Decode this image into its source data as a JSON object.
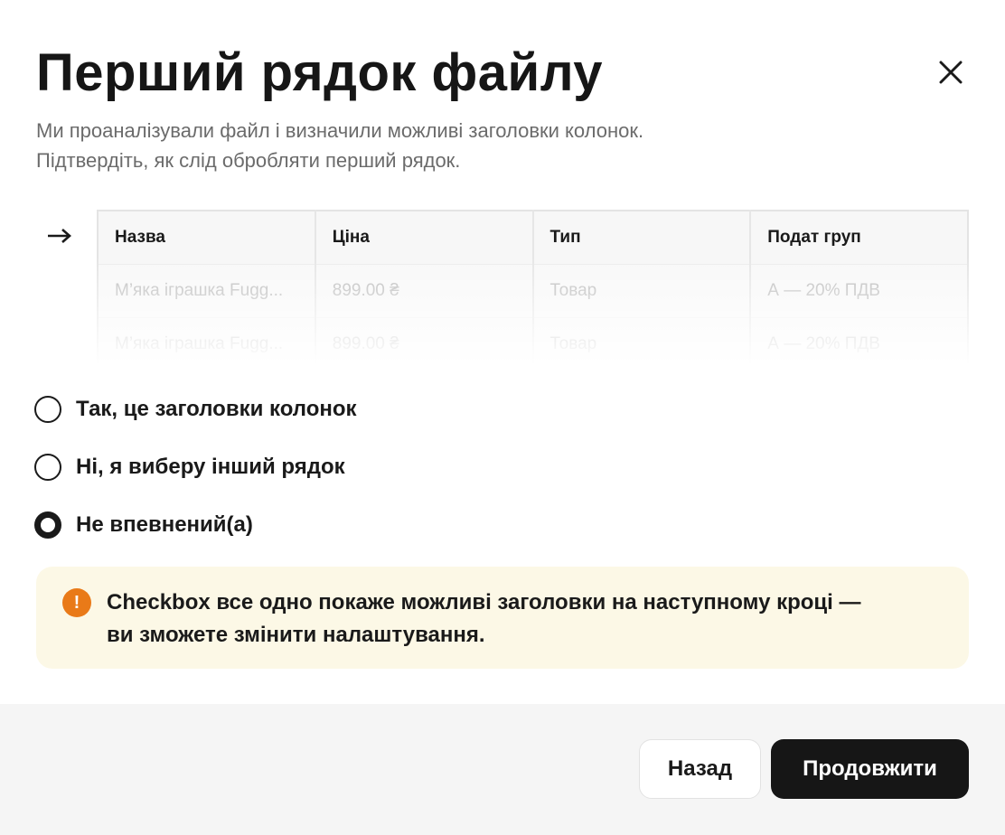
{
  "dialog": {
    "title": "Перший рядок файлу",
    "subtitle_lines": [
      "Ми проаналізували файл і визначили можливі заголовки колонок.",
      "Підтвердіть, як слід обробляти перший рядок."
    ]
  },
  "preview_table": {
    "headers": [
      "Назва",
      "Ціна",
      "Тип",
      "Подат груп"
    ],
    "rows": [
      [
        "М’яка іграшка Fugg...",
        "899.00 ₴",
        "Товар",
        "А — 20% ПДВ"
      ],
      [
        "М’яка іграшка Fugg...",
        "899.00 ₴",
        "Товар",
        "А — 20% ПДВ"
      ]
    ]
  },
  "options": [
    {
      "label": "Так, це заголовки колонок",
      "selected": false
    },
    {
      "label": "Ні, я виберу інший рядок",
      "selected": false
    },
    {
      "label": "Не впевнений(а)",
      "selected": true
    }
  ],
  "note": {
    "icon": "!",
    "lines": [
      "Checkbox все одно покаже можливі заголовки на наступному кроці —",
      "ви зможете змінити налаштування."
    ]
  },
  "footer": {
    "back_label": "Назад",
    "continue_label": "Продовжити"
  },
  "colors": {
    "primary_button": "#161616",
    "note_background": "#fcf8e6",
    "warning_icon": "#e97a18",
    "footer_background": "#f5f5f5"
  }
}
